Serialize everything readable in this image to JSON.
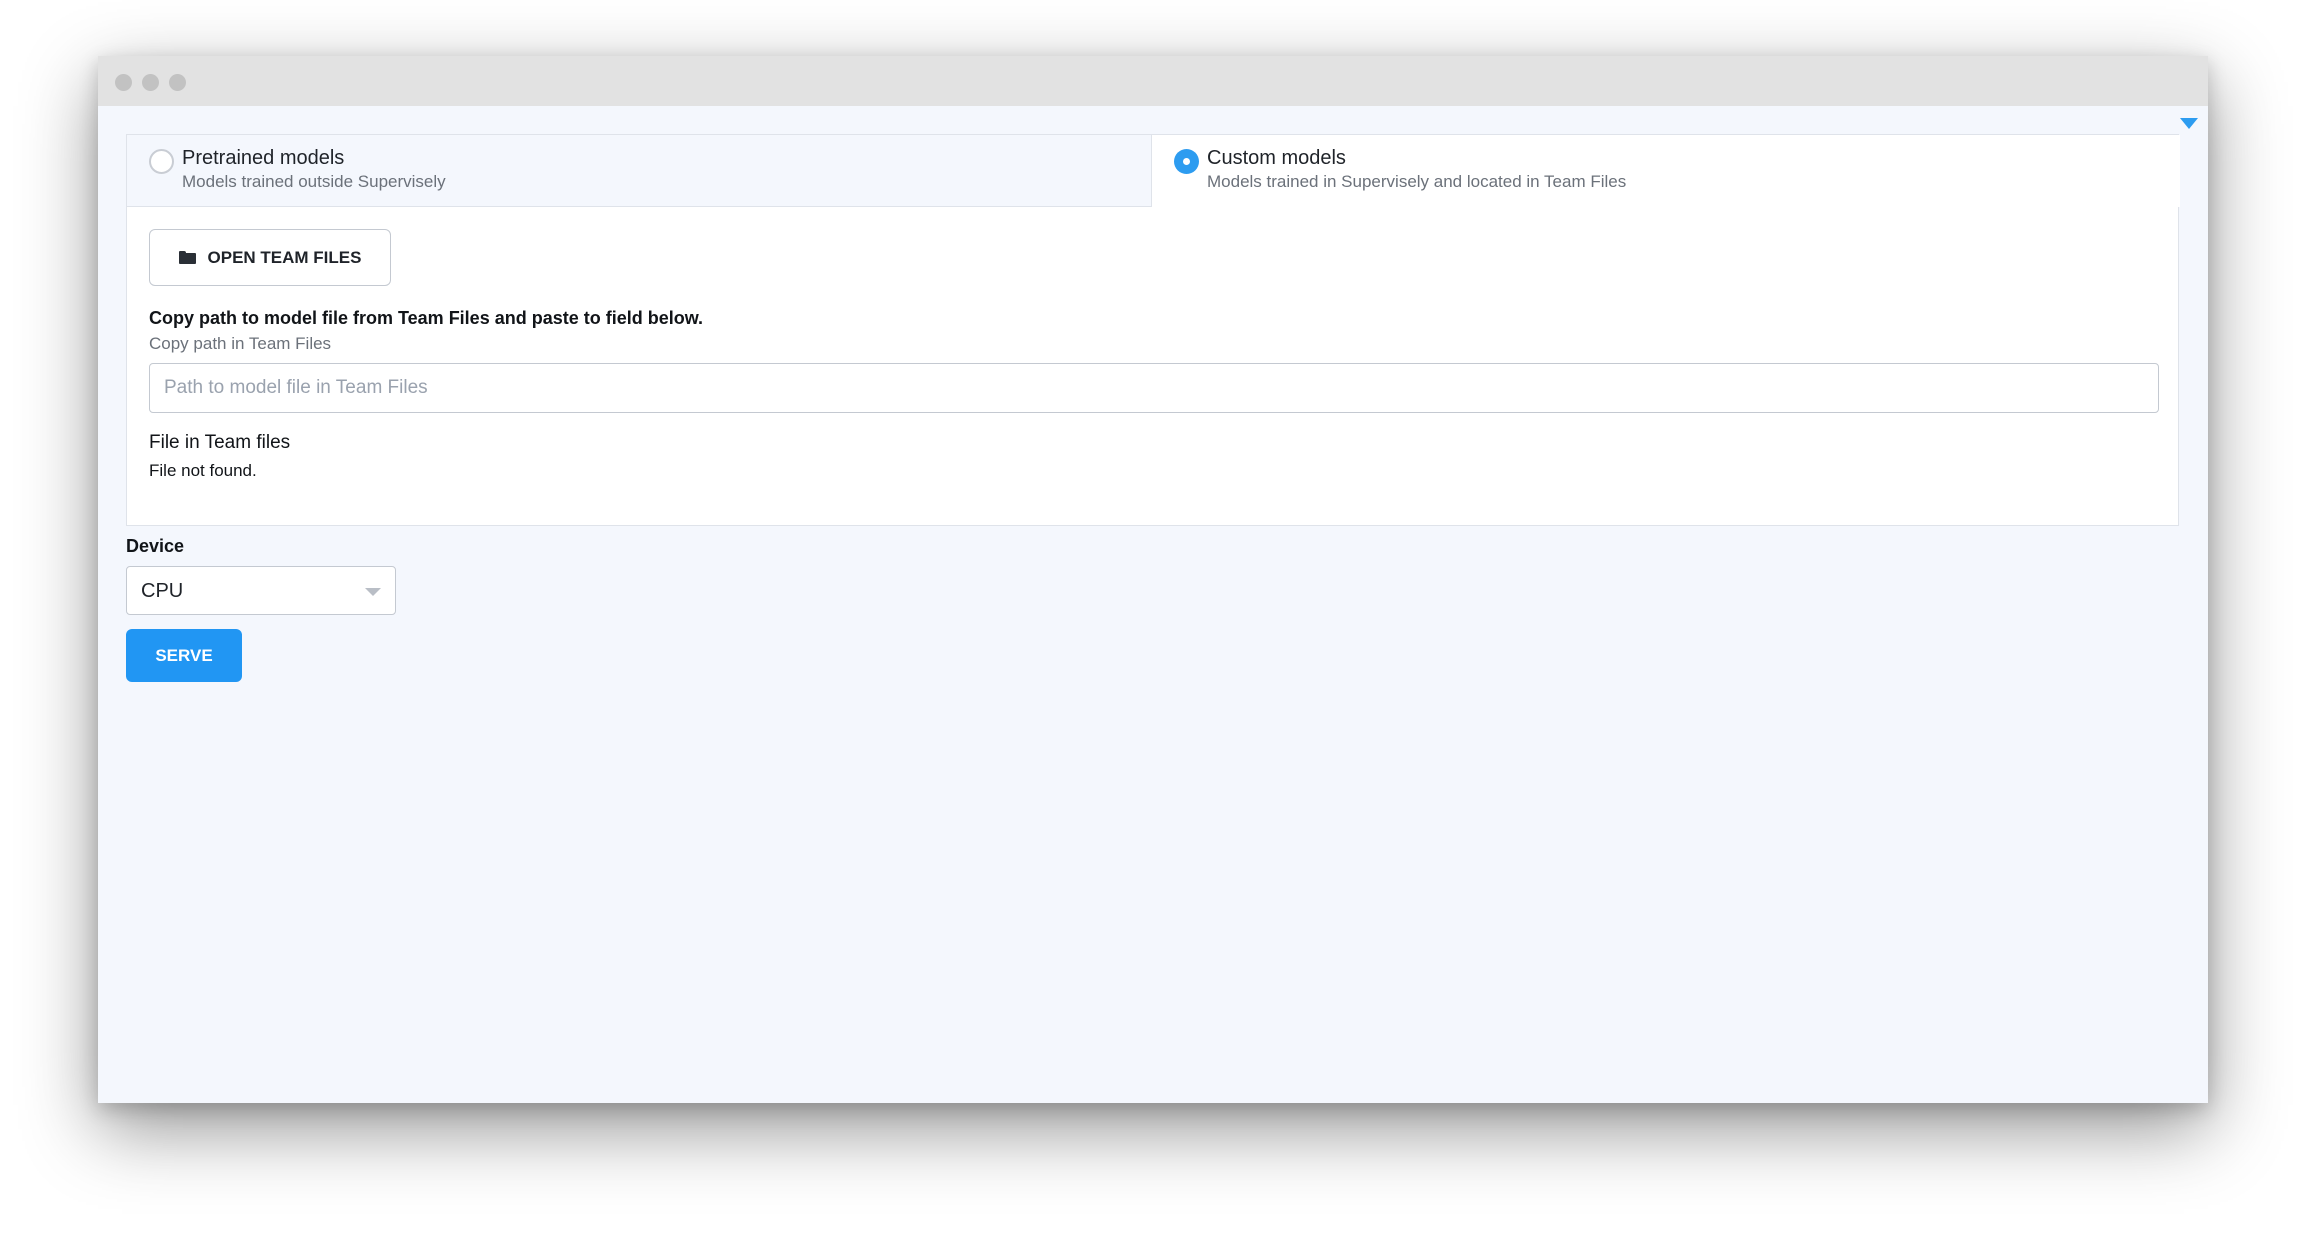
{
  "models": {
    "pretrained": {
      "title": "Pretrained models",
      "subtitle": "Models trained outside Supervisely",
      "selected": false
    },
    "custom": {
      "title": "Custom models",
      "subtitle": "Models trained in Supervisely and located in Team Files",
      "selected": true
    }
  },
  "team_files": {
    "open_button": "OPEN TEAM FILES",
    "instruction": "Copy path to model file from Team Files and paste to field below.",
    "instruction_sub": "Copy path in Team Files",
    "path_value": "",
    "path_placeholder": "Path to model file in Team Files",
    "file_label": "File in Team files",
    "file_status": "File not found."
  },
  "device": {
    "label": "Device",
    "selected": "CPU"
  },
  "serve_label": "SERVE",
  "colors": {
    "accent": "#2196f3",
    "window_bg": "#f4f7fd"
  },
  "icons": {
    "window_controls": "traffic-light-dots",
    "collapse": "triangle-down-icon",
    "folder": "folder-icon",
    "select": "chevron-down-icon"
  }
}
